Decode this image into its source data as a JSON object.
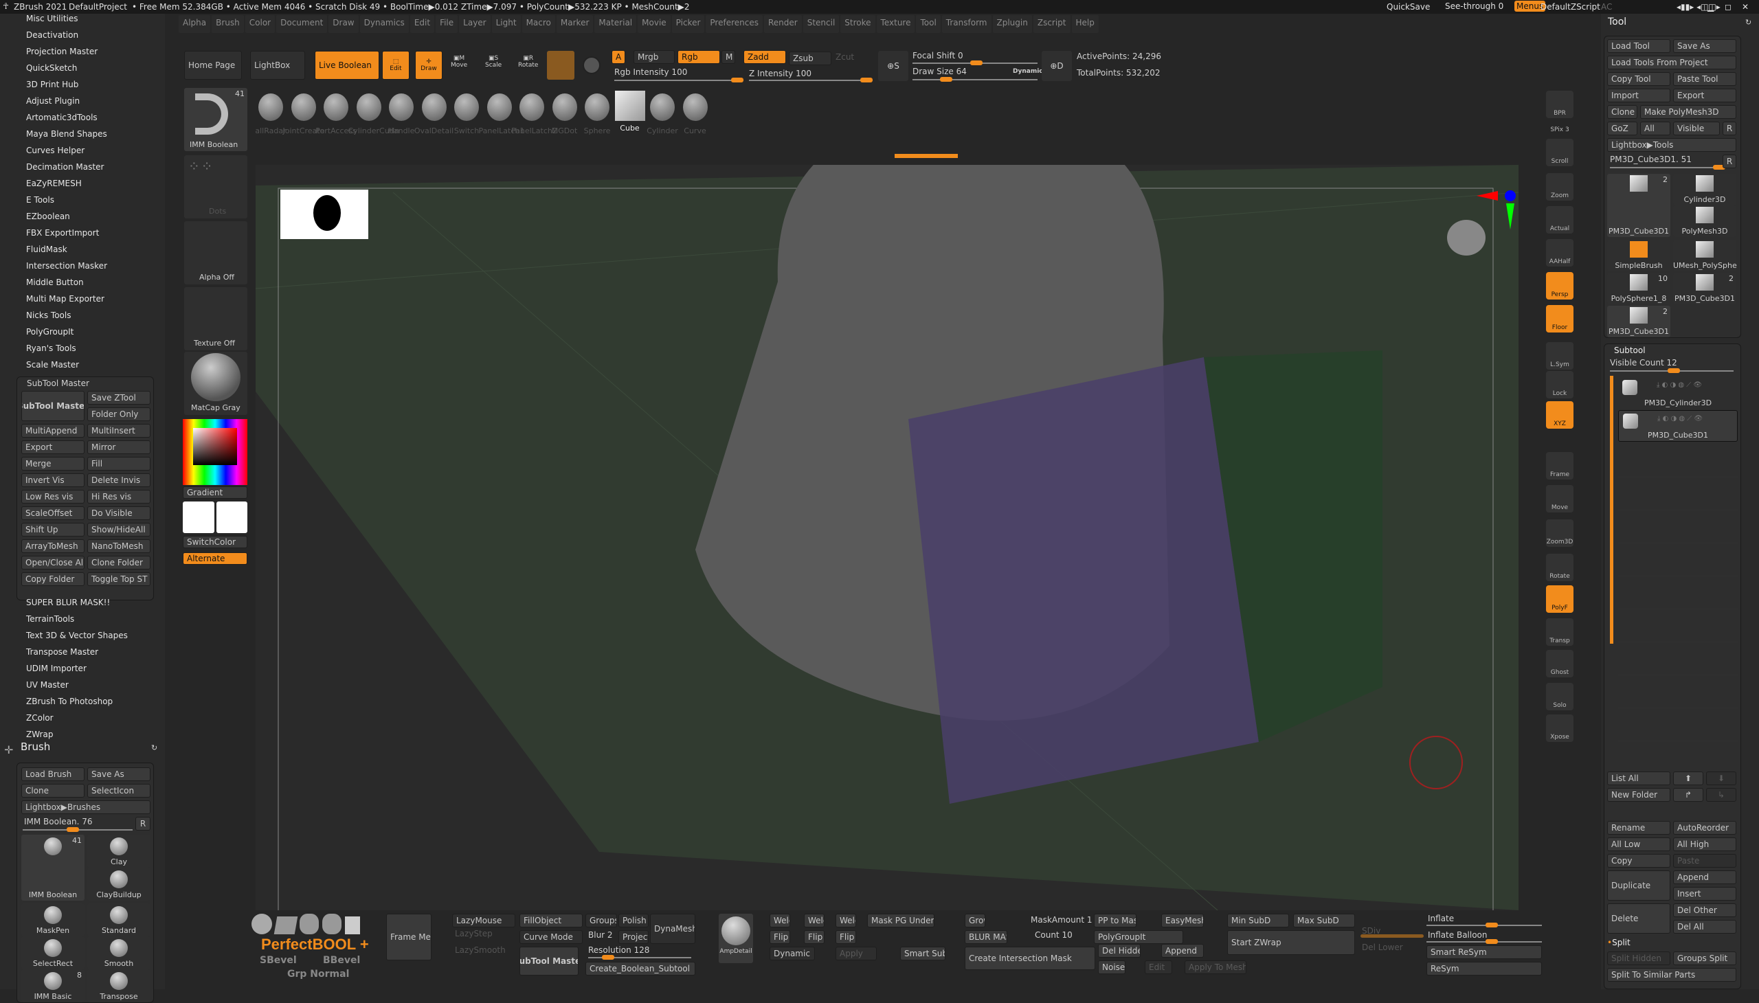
{
  "titlebar": {
    "app": "ZBrush 2021",
    "project": "DefaultProject",
    "stats": "• Free Mem 52.384GB • Active Mem 4046 • Scratch Disk 49 •  BoolTime▶0.012 ZTime▶7.097 • PolyCount▶532.223 KP  • MeshCount▶2",
    "ac": "AC",
    "quicksave": "QuickSave",
    "see_through": "See-through  0",
    "see_through_value": 0,
    "menus": "Menus",
    "zscript": "DefaultZScript"
  },
  "menu": [
    "Alpha",
    "Brush",
    "Color",
    "Document",
    "Draw",
    "Dynamics",
    "Edit",
    "File",
    "Layer",
    "Light",
    "Macro",
    "Marker",
    "Material",
    "Movie",
    "Picker",
    "Preferences",
    "Render",
    "Stencil",
    "Stroke",
    "Texture",
    "Tool",
    "Transform",
    "Zplugin",
    "Zscript",
    "Help"
  ],
  "zplugin": {
    "items_top": [
      "Misc Utilities",
      "Deactivation",
      "Projection Master",
      "QuickSketch",
      "3D Print Hub",
      "Adjust Plugin",
      "Artomatic3dTools",
      "Maya Blend Shapes",
      "Curves Helper",
      "Decimation Master",
      "EaZyREMESH",
      "E Tools",
      "EZboolean",
      "FBX ExportImport",
      "FluidMask",
      "Intersection Masker",
      "Middle Button",
      "Multi Map Exporter",
      "Nicks Tools",
      "PolyGroupIt",
      "Ryan's Tools",
      "Scale Master"
    ],
    "subtool_master": {
      "title": "SubTool Master",
      "big_button": "SubTool Master",
      "buttons": [
        "Save ZTool",
        "Folder Only",
        "MultiAppend",
        "MultiInsert",
        "Export",
        "Mirror",
        "Merge",
        "Fill",
        "Invert Vis",
        "Delete Invis",
        "Low Res vis",
        "Hi Res vis",
        "ScaleOffset",
        "Do Visible",
        "Shift Up",
        "Show/HideAll",
        "ArrayToMesh",
        "NanoToMesh",
        "Open/Close All",
        "Clone Folder",
        "Copy Folder",
        "Toggle Top ST"
      ]
    },
    "items_bottom": [
      "SUPER BLUR MASK!!",
      "TerrainTools",
      "Text 3D & Vector Shapes",
      "Transpose Master",
      "UDIM Importer",
      "UV Master",
      "ZBrush To Photoshop",
      "ZColor",
      "ZWrap"
    ]
  },
  "brush": {
    "title": "Brush",
    "load": "Load Brush",
    "save_as": "Save As",
    "clone": "Clone",
    "select_icon": "SelectIcon",
    "lightbox": "Lightbox▶Brushes",
    "current": "IMM Boolean. 76",
    "current_value": 76,
    "r": "R",
    "items": [
      {
        "name": "IMM Boolean",
        "count": "41"
      },
      {
        "name": "Clay"
      },
      {
        "name": "ClayBuildup"
      },
      {
        "name": "MaskPen"
      },
      {
        "name": "Standard"
      },
      {
        "name": "SelectRect"
      },
      {
        "name": "Smooth"
      },
      {
        "name": "IMM Basic",
        "count": "8"
      },
      {
        "name": "Transpose"
      }
    ]
  },
  "shelf": {
    "home": "Home Page",
    "lightbox": "LightBox",
    "live_boolean": "Live Boolean",
    "edit": "Edit",
    "draw": "Draw",
    "move": "Move",
    "scale": "Scale",
    "rotate": "Rotate",
    "a": "A",
    "mrgb": "Mrgb",
    "rgb": "Rgb",
    "m": "M",
    "zadd": "Zadd",
    "zsub": "Zsub",
    "zcut": "Zcut",
    "rgb_intensity": "Rgb Intensity 100",
    "rgb_intensity_value": 100,
    "z_intensity": "Z Intensity 100",
    "z_intensity_value": 100,
    "focal_shift": "Focal Shift 0",
    "focal_shift_value": 0,
    "draw_size": "Draw Size 64",
    "draw_size_value": 64,
    "dynamic": "Dynamic",
    "active_points": "ActivePoints: 24,296",
    "total_points": "TotalPoints: 532,202"
  },
  "insert_bar": {
    "current": "IMM Boolean",
    "count": "41",
    "items": [
      "allRadar",
      "JointCreate",
      "PortAccess",
      "CylinderCutIn",
      "Handle",
      "OvalDetail",
      "Switch",
      "PanelLatch1",
      "PanelLatch2",
      "MGDot",
      "Sphere",
      "Cube",
      "Cylinder",
      "Curve"
    ],
    "selected": "Cube"
  },
  "left_shelf": {
    "stroke": "Dots",
    "alpha": "Alpha Off",
    "texture": "Texture Off",
    "material": "MatCap Gray",
    "gradient": "Gradient",
    "switch_color": "SwitchColor",
    "alternate": "Alternate"
  },
  "right_shelf": [
    {
      "label": "BPR"
    },
    {
      "label": "SPix 3"
    },
    {
      "label": "Scroll"
    },
    {
      "label": "Zoom"
    },
    {
      "label": "Actual"
    },
    {
      "label": "AAHalf"
    },
    {
      "label": "Persp",
      "active": true
    },
    {
      "label": "Floor",
      "active": true
    },
    {
      "label": "L.Sym"
    },
    {
      "label": "Lock"
    },
    {
      "label": "XYZ",
      "active": true
    },
    {
      "label": "Frame"
    },
    {
      "label": "Move"
    },
    {
      "label": "Zoom3D"
    },
    {
      "label": "Rotate"
    },
    {
      "label": "PolyF",
      "active": true
    },
    {
      "label": "Transp"
    },
    {
      "label": "Ghost"
    },
    {
      "label": "Solo"
    },
    {
      "label": "Xpose"
    }
  ],
  "tool": {
    "title": "Tool",
    "load": "Load Tool",
    "save_as": "Save As",
    "load_project": "Load Tools From Project",
    "copy": "Copy Tool",
    "paste": "Paste Tool",
    "import": "Import",
    "export": "Export",
    "clone": "Clone",
    "make_polymesh": "Make PolyMesh3D",
    "goz": "GoZ",
    "all": "All",
    "visible": "Visible",
    "r": "R",
    "lightbox": "Lightbox▶Tools",
    "current": "PM3D_Cube3D1. 51",
    "current_value": 51,
    "items": [
      {
        "name": "PM3D_Cube3D1",
        "count": "2"
      },
      {
        "name": "Cylinder3D"
      },
      {
        "name": "PolyMesh3D"
      },
      {
        "name": "SimpleBrush"
      },
      {
        "name": "UMesh_PolySphe"
      },
      {
        "name": "PolySphere1_8",
        "count": "10"
      },
      {
        "name": "PM3D_Cube3D1",
        "count": "2"
      },
      {
        "name": "PM3D_Cube3D1",
        "count": "2"
      }
    ]
  },
  "subtool": {
    "title": "Subtool",
    "visible_count": "Visible Count 12",
    "visible_count_value": 12,
    "items": [
      "PM3D_Cylinder3D",
      "PM3D_Cube3D1"
    ],
    "list_all": "List All",
    "new_folder": "New Folder",
    "rename": "Rename",
    "auto_reorder": "AutoReorder",
    "all_low": "All Low",
    "all_high": "All High",
    "copy": "Copy",
    "paste": "Paste",
    "duplicate": "Duplicate",
    "append": "Append",
    "insert": "Insert",
    "delete": "Delete",
    "del_other": "Del Other",
    "del_all": "Del All",
    "split": "Split",
    "split_hidden": "Split Hidden",
    "groups_split": "Groups Split",
    "split_similar": "Split To Similar Parts"
  },
  "bottom": {
    "perfect_bool": "PerfectBOOL +",
    "sbevel": "SBevel",
    "bbevel": "BBevel",
    "grp_normal": "Grp Normal",
    "frame_mesh": "Frame Mesh",
    "lazy_mouse": "LazyMouse",
    "lazy_step": "LazyStep",
    "lazy_smooth": "LazySmooth",
    "fill_object": "FillObject",
    "curve_mode": "Curve Mode",
    "subtool_master": "SubTool Master",
    "groups": "Groups",
    "polish": "Polish",
    "blur": "Blur 2",
    "project": "Project",
    "dynamesh": "DynaMesh",
    "resolution": "Resolution 128",
    "resolution_value": 128,
    "create_bool": "Create_Boolean_Subtool",
    "amp_detail": "AmpDetail",
    "weldx": "WeldX",
    "weldy": "WeldY",
    "weldz": "WeldZ",
    "mask_pg": "Mask PG Under Cursor",
    "flipx": "Flip X",
    "flipy": "Flip Y",
    "flipz": "Flip Z",
    "dynamic": "Dynamic",
    "apply": "Apply",
    "smart_subdiv": "Smart Subdiv",
    "grow": "Grow",
    "blur_mask": "BLUR MASK!!",
    "mask_amount": "MaskAmount 1",
    "count": "Count 10",
    "create_intersection": "Create Intersection Mask",
    "pp_to_mask": "PP to Mask",
    "easymesh": "EasyMesh",
    "polygroupit": "PolyGroupIt",
    "del_hidden": "Del Hidden",
    "append": "Append",
    "noise": "Noise",
    "edit": "Edit",
    "apply_to_mesh": "Apply To Mesh",
    "min_subd": "Min SubD",
    "max_subd": "Max SubD",
    "start_zwrap": "Start ZWrap",
    "sdiv": "SDiv",
    "del_lower": "Del Lower",
    "inflate": "Inflate",
    "inflate_balloon": "Inflate Balloon",
    "smart_resym": "Smart ReSym",
    "resym": "ReSym"
  },
  "colors": {
    "accent": "#f28c1c",
    "bg": "#262626",
    "viewport": "#313b30"
  }
}
